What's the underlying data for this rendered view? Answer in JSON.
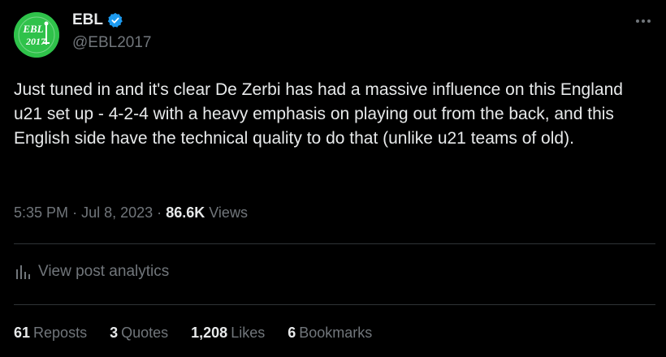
{
  "author": {
    "display_name": "EBL",
    "handle": "@EBL2017",
    "avatar_text_top": "EBL",
    "avatar_text_bottom": "2017",
    "verified": true
  },
  "post": {
    "text": "Just tuned in and it's clear De Zerbi has had a massive influence on this England u21 set up - 4-2-4 with a heavy emphasis on playing out from the back, and this English side have the technical quality to do that (unlike u21 teams of old)."
  },
  "meta": {
    "time": "5:35 PM",
    "separator": "·",
    "date": "Jul 8, 2023",
    "views_count": "86.6K",
    "views_label": "Views"
  },
  "analytics": {
    "label": "View post analytics"
  },
  "stats": {
    "reposts_count": "61",
    "reposts_label": "Reposts",
    "quotes_count": "3",
    "quotes_label": "Quotes",
    "likes_count": "1,208",
    "likes_label": "Likes",
    "bookmarks_count": "6",
    "bookmarks_label": "Bookmarks"
  },
  "colors": {
    "background": "#000000",
    "primary_text": "#e7e9ea",
    "secondary_text": "#71767b",
    "verified_badge": "#1d9bf0",
    "avatar_bg": "#2fc24a",
    "divider": "#2f3336"
  },
  "icons": {
    "verified": "verified-badge-icon",
    "more": "more-horizontal-icon",
    "analytics": "bar-chart-icon"
  }
}
